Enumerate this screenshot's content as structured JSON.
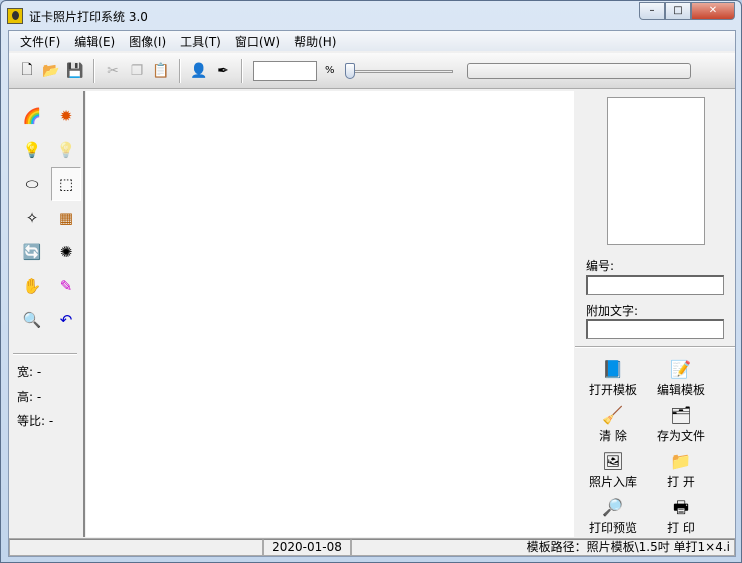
{
  "window": {
    "title": "证卡照片打印系统 3.0",
    "min": "–",
    "max": "□",
    "close": "✕"
  },
  "menu": [
    "文件(F)",
    "编辑(E)",
    "图像(I)",
    "工具(T)",
    "窗口(W)",
    "帮助(H)"
  ],
  "toolbar": {
    "zoom_value": "",
    "percent": "%",
    "zoom_level": 0
  },
  "left": {
    "width_label": "宽: -",
    "height_label": "高: -",
    "ratio_label": "等比: -"
  },
  "right": {
    "number_label": "编号:",
    "number_value": "",
    "text_label": "附加文字:",
    "text_value": "",
    "actions": [
      "打开模板",
      "编辑模板",
      "清 除",
      "存为文件",
      "照片入库",
      "打 开",
      "打印预览",
      "打 印"
    ]
  },
  "status": {
    "left": "",
    "date": "2020-01-08",
    "path": "模板路径：照片模板\\1.5吋 单打1×4.i"
  },
  "colors": {
    "close": "#c8462f",
    "titlebar": "#dbe7f5"
  }
}
